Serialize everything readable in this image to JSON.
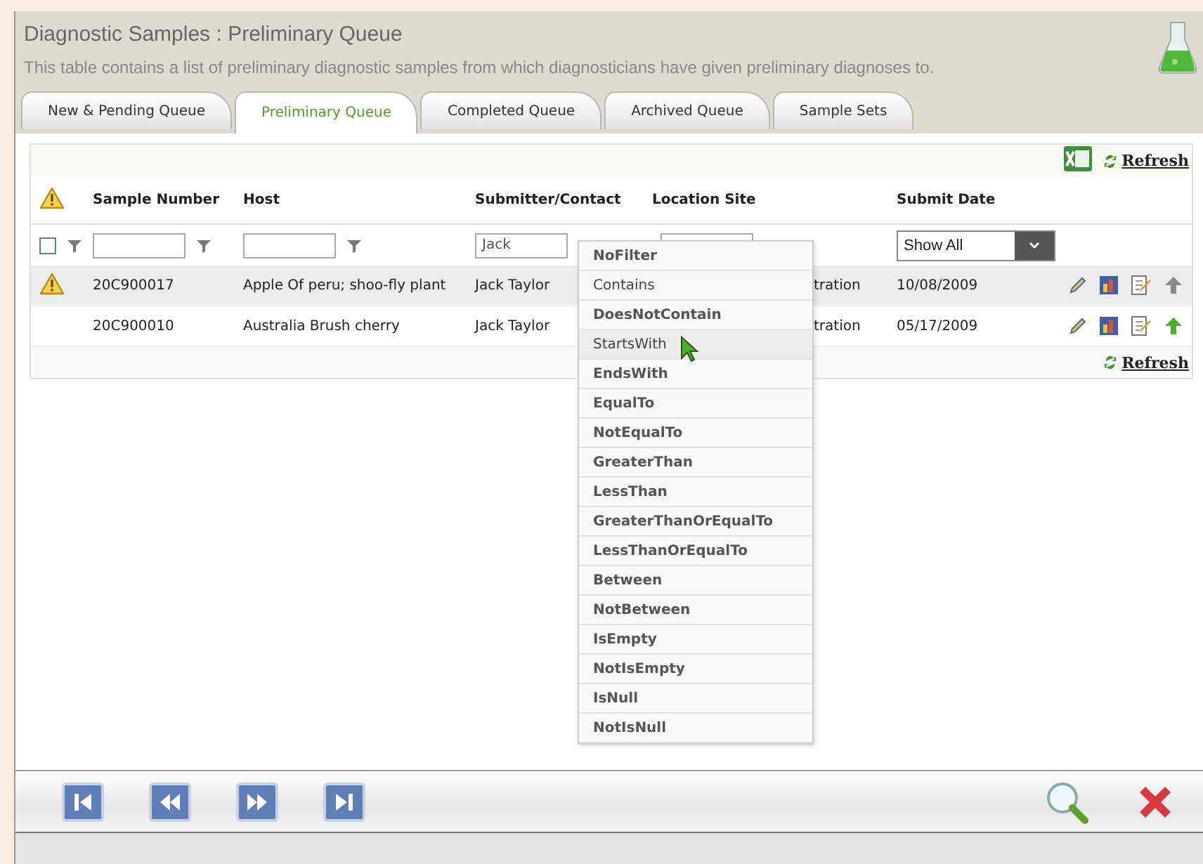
{
  "header": {
    "title": "Diagnostic Samples : Preliminary Queue",
    "description": "This table contains a list of preliminary diagnostic samples from which diagnosticians have given preliminary diagnoses to."
  },
  "tabs": [
    {
      "label": "New & Pending Queue",
      "selected": false
    },
    {
      "label": "Preliminary Queue",
      "selected": true
    },
    {
      "label": "Completed Queue",
      "selected": false
    },
    {
      "label": "Archived Queue",
      "selected": false
    },
    {
      "label": "Sample Sets",
      "selected": false
    }
  ],
  "toolbar": {
    "refresh": "Refresh"
  },
  "table": {
    "columns": [
      "Sample Number",
      "Host",
      "Submitter/Contact",
      "Location Site",
      "Submit Date"
    ],
    "filters": {
      "all_checked": false,
      "submitter": "Jack",
      "date": "Show All"
    },
    "rows": [
      {
        "sample_number": "20C900017",
        "host": "Apple Of peru; shoo-fly plant",
        "submitter": "Jack Taylor",
        "location": "tration",
        "date": "10/08/2009",
        "warning": true,
        "selected": true,
        "upload_enabled": false
      },
      {
        "sample_number": "20C900010",
        "host": "Australia Brush cherry",
        "submitter": "Jack Taylor",
        "location": "tration",
        "date": "05/17/2009",
        "warning": false,
        "selected": false,
        "upload_enabled": true
      }
    ],
    "footer_refresh": "Refresh"
  },
  "filter_menu": [
    {
      "label": "NoFilter",
      "bold": true,
      "selected": false
    },
    {
      "label": "Contains",
      "bold": false,
      "selected": false
    },
    {
      "label": "DoesNotContain",
      "bold": true,
      "selected": false
    },
    {
      "label": "StartsWith",
      "bold": false,
      "selected": true
    },
    {
      "label": "EndsWith",
      "bold": true,
      "selected": false
    },
    {
      "label": "EqualTo",
      "bold": true,
      "selected": false
    },
    {
      "label": "NotEqualTo",
      "bold": true,
      "selected": false
    },
    {
      "label": "GreaterThan",
      "bold": true,
      "selected": false
    },
    {
      "label": "LessThan",
      "bold": true,
      "selected": false
    },
    {
      "label": "GreaterThanOrEqualTo",
      "bold": true,
      "selected": false
    },
    {
      "label": "LessThanOrEqualTo",
      "bold": true,
      "selected": false
    },
    {
      "label": "Between",
      "bold": true,
      "selected": false
    },
    {
      "label": "NotBetween",
      "bold": true,
      "selected": false
    },
    {
      "label": "IsEmpty",
      "bold": true,
      "selected": false
    },
    {
      "label": "NotIsEmpty",
      "bold": true,
      "selected": false
    },
    {
      "label": "IsNull",
      "bold": true,
      "selected": false
    },
    {
      "label": "NotIsNull",
      "bold": true,
      "selected": false
    }
  ]
}
